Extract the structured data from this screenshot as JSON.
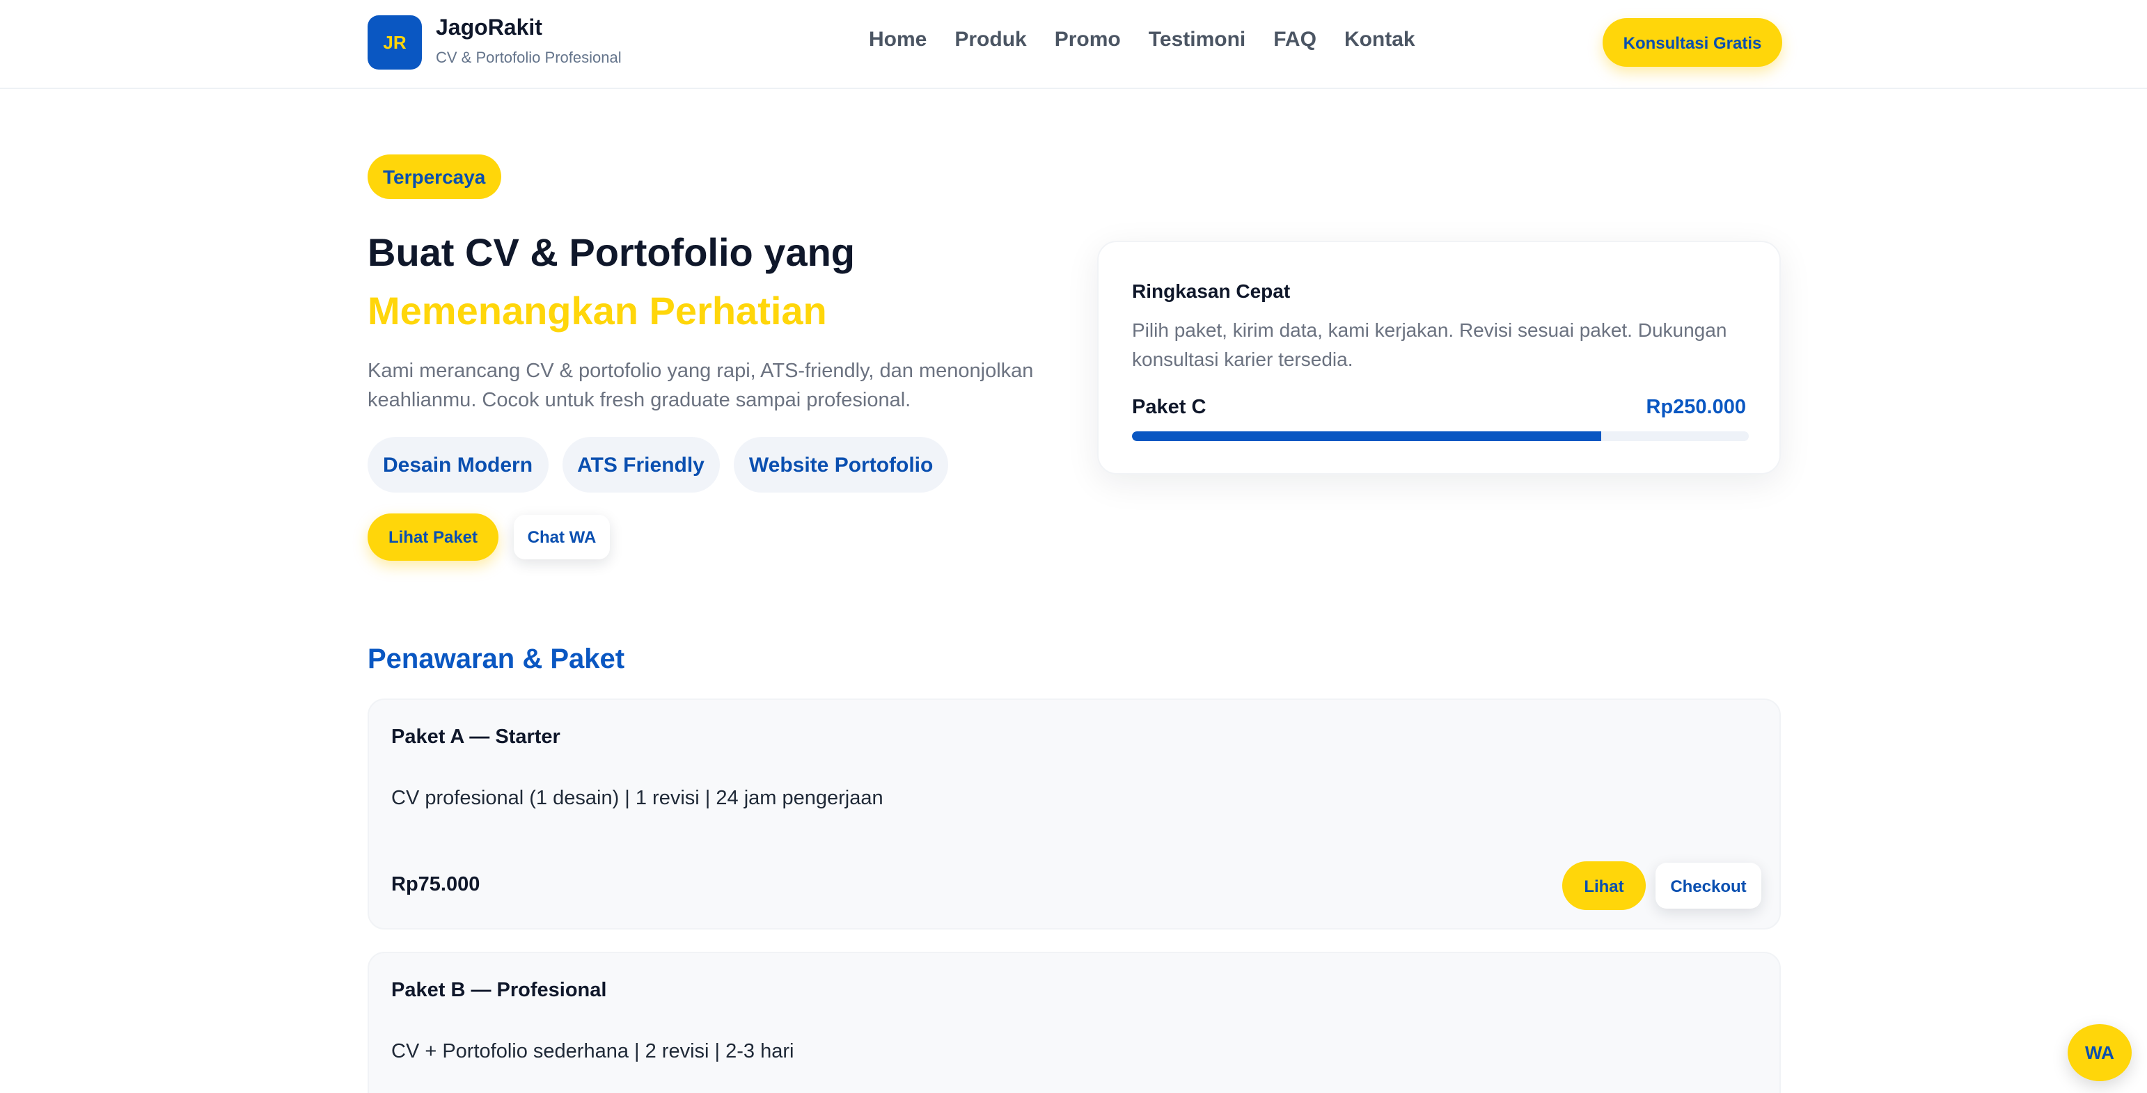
{
  "brand": {
    "initials": "JR",
    "name": "JagoRakit",
    "tagline": "CV & Portofolio Profesional"
  },
  "nav": {
    "items": [
      "Home",
      "Produk",
      "Promo",
      "Testimoni",
      "FAQ",
      "Kontak"
    ]
  },
  "header": {
    "cta_label": "Konsultasi Gratis"
  },
  "hero": {
    "badge": "Terpercaya",
    "title_line1": "Buat CV & Portofolio yang",
    "title_line2": "Memenangkan Perhatian",
    "description": "Kami merancang CV & portofolio yang rapi, ATS-friendly, dan menonjolkan keahlianmu. Cocok untuk fresh graduate sampai profesional.",
    "chips": [
      "Desain Modern",
      "ATS Friendly",
      "Website Portofolio"
    ],
    "primary_button": "Lihat Paket",
    "secondary_button": "Chat WA"
  },
  "summary": {
    "title": "Ringkasan Cepat",
    "description": "Pilih paket, kirim data, kami kerjakan. Revisi sesuai paket. Dukungan konsultasi karier tersedia.",
    "package": "Paket C",
    "price": "Rp250.000",
    "progress_fraction": 0.76
  },
  "packages": {
    "section_title": "Penawaran & Paket",
    "items": [
      {
        "name": "Paket A — Starter",
        "description": "CV profesional (1 desain) | 1 revisi | 24 jam pengerjaan",
        "price": "Rp75.000",
        "view_label": "Lihat",
        "checkout_label": "Checkout"
      },
      {
        "name": "Paket B — Profesional",
        "description": "CV + Portofolio sederhana | 2 revisi | 2-3 hari"
      }
    ]
  },
  "floating": {
    "wa_label": "WA"
  },
  "colors": {
    "brand_blue": "#0a57c2",
    "accent_yellow": "#ffd60a",
    "text_dark": "#0f172a",
    "text_muted": "#6b7280"
  }
}
